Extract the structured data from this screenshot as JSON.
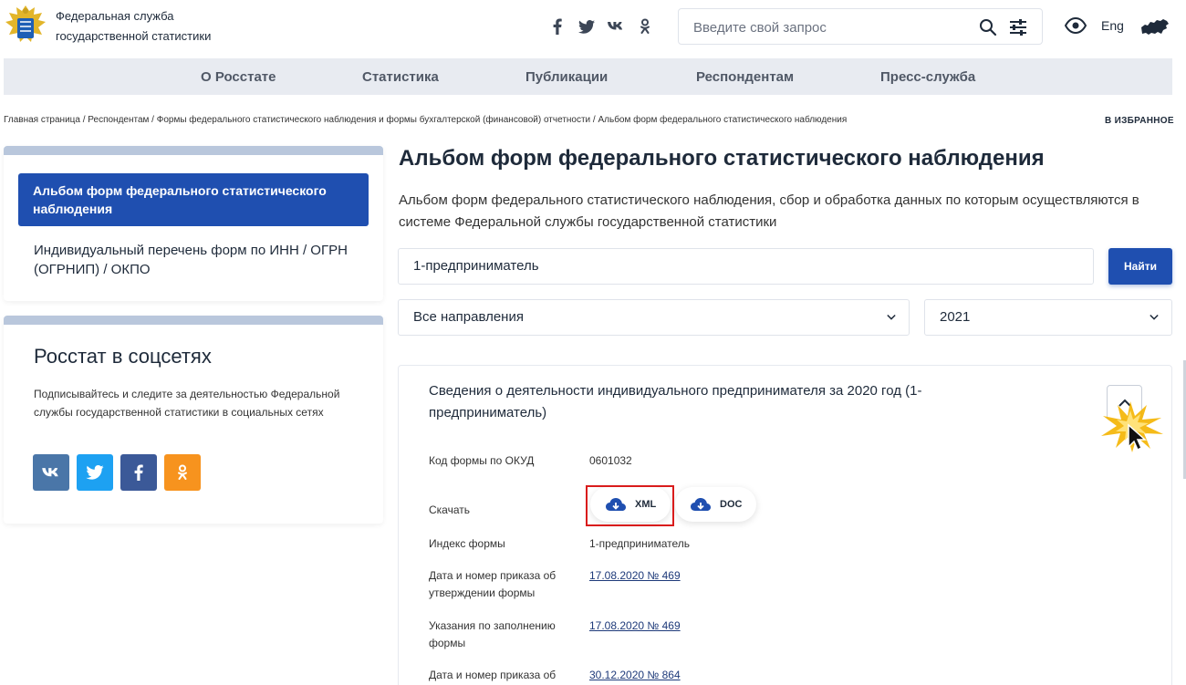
{
  "header": {
    "site_name_line1": "Федеральная служба",
    "site_name_line2": "государственной статистики",
    "search_placeholder": "Введите свой запрос",
    "lang": "Eng",
    "social_icons": [
      "facebook-icon",
      "twitter-icon",
      "vk-icon",
      "odnoklassniki-icon"
    ]
  },
  "nav": {
    "items": [
      "О Росстате",
      "Статистика",
      "Публикации",
      "Респондентам",
      "Пресс-служба"
    ]
  },
  "breadcrumbs": "Главная страница / Респондентам / Формы федерального статистического наблюдения и формы бухгалтерской (финансовой) отчетности / Альбом форм федерального статистического наблюдения",
  "favorites": "В ИЗБРАННОЕ",
  "sidebar": {
    "active_item": "Альбом форм федерального статистического наблюдения",
    "item2": "Индивидуальный перечень форм по ИНН / ОГРН (ОГРНИП) / ОКПО",
    "social_title": "Росстат в соцсетях",
    "social_text": "Подписывайтесь и следите за деятельностью Федеральной службы государственной статистики в социальных сетях",
    "buttons": [
      {
        "label": "vk",
        "color": "#4a76a8"
      },
      {
        "label": "tw",
        "color": "#1da1f2"
      },
      {
        "label": "f",
        "color": "#3b5998"
      },
      {
        "label": "ok",
        "color": "#f7931e"
      }
    ]
  },
  "main": {
    "title": "Альбом форм федерального статистического наблюдения",
    "description": "Альбом форм федерального статистического наблюдения, сбор и обработка данных по которым осуществляются в системе Федеральной службы государственной статистики",
    "search_value": "1-предприниматель",
    "find_button": "Найти",
    "direction_select": "Все направления",
    "year_select": "2021"
  },
  "card": {
    "title": "Сведения о деятельности индивидуального предпринимателя за 2020 год (1-предприниматель)",
    "okud_label": "Код формы по ОКУД",
    "okud_value": "0601032",
    "download_label": "Скачать",
    "xml_label": "XML",
    "doc_label": "DOC",
    "index_label": "Индекс формы",
    "index_value": "1-предприниматель",
    "order_label": "Дата и номер приказа об утверждении формы",
    "order_value": "17.08.2020 № 469",
    "instructions_label": "Указания по заполнению формы",
    "instructions_value": "17.08.2020 № 469",
    "order2_label": "Дата и номер приказа об",
    "order2_value": "30.12.2020 № 864"
  },
  "colors": {
    "accent": "#1f4fb0",
    "nav_bg": "#e8ebf1",
    "highlight": "#d91c1c"
  }
}
